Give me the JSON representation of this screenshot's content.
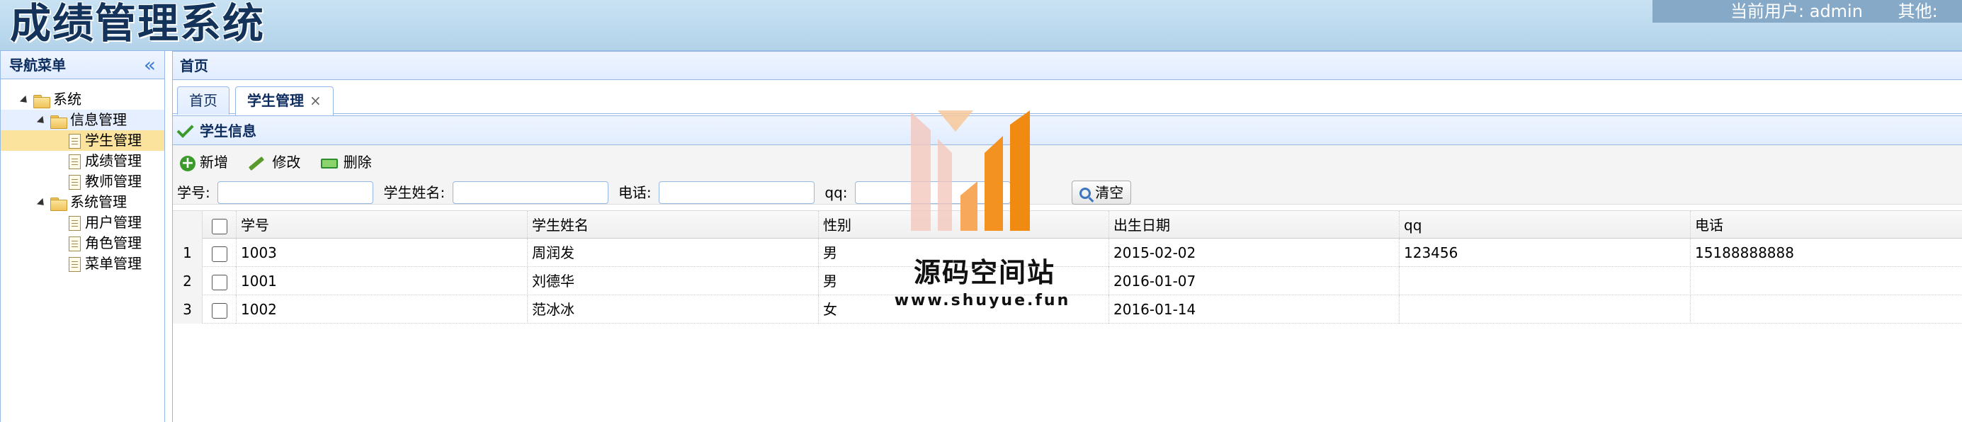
{
  "header": {
    "app_title": "成绩管理系统",
    "current_user_label": "当前用户:",
    "current_user": "admin",
    "other_label": "其他:"
  },
  "nav": {
    "title": "导航菜单",
    "collapse_icon": "double-chevron-left-icon",
    "tree": {
      "root": "系统",
      "info_mgmt": "信息管理",
      "student_mgmt": "学生管理",
      "score_mgmt": "成绩管理",
      "teacher_mgmt": "教师管理",
      "sys_mgmt": "系统管理",
      "user_mgmt": "用户管理",
      "role_mgmt": "角色管理",
      "menu_mgmt": "菜单管理"
    }
  },
  "main": {
    "title": "首页",
    "tabs": [
      {
        "label": "首页"
      },
      {
        "label": "学生管理",
        "close": "×"
      }
    ],
    "grid_title": "学生信息",
    "toolbar": {
      "add": "新增",
      "edit": "修改",
      "delete": "删除"
    },
    "search": {
      "student_no_label": "学号:",
      "student_name_label": "学生姓名:",
      "phone_label": "电话:",
      "qq_label": "qq:",
      "clear_label": "清空"
    },
    "table": {
      "columns": [
        "学号",
        "学生姓名",
        "性别",
        "出生日期",
        "qq",
        "电话"
      ],
      "rows": [
        {
          "idx": "1",
          "no": "1003",
          "name": "周润发",
          "gender": "男",
          "birth": "2015-02-02",
          "qq": "123456",
          "phone": "15188888888"
        },
        {
          "idx": "2",
          "no": "1001",
          "name": "刘德华",
          "gender": "男",
          "birth": "2016-01-07",
          "qq": "",
          "phone": ""
        },
        {
          "idx": "3",
          "no": "1002",
          "name": "范冰冰",
          "gender": "女",
          "birth": "2016-01-14",
          "qq": "",
          "phone": ""
        }
      ]
    }
  },
  "watermark": {
    "title": "源码空间站",
    "url": "www.shuyue.fun"
  },
  "colors": {
    "header_bg": "#b3d3ea",
    "panel_border": "#95b8e7",
    "selected_node": "#fbe39e",
    "watermark_orange": "#f39121"
  }
}
